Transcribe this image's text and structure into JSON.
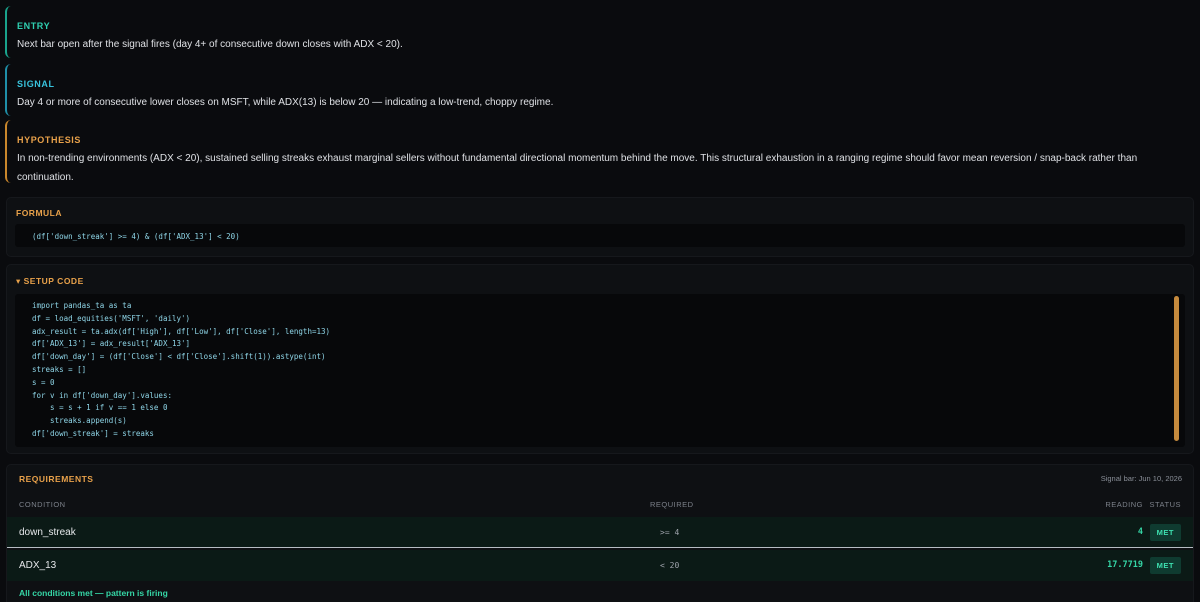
{
  "entry": {
    "label": "ENTRY",
    "text": "Next bar open after the signal fires (day 4+ of consecutive down closes with ADX < 20)."
  },
  "signal": {
    "label": "SIGNAL",
    "text": "Day 4 or more of consecutive lower closes on MSFT, while ADX(13) is below 20 — indicating a low-trend, choppy regime."
  },
  "hypothesis": {
    "label": "HYPOTHESIS",
    "text": "In non-trending environments (ADX < 20), sustained selling streaks exhaust marginal sellers without fundamental directional momentum behind the move. This structural exhaustion in a ranging regime should favor mean reversion / snap-back rather than continuation."
  },
  "formula": {
    "title": "FORMULA",
    "code": "(df['down_streak'] >= 4) & (df['ADX_13'] < 20)"
  },
  "setup": {
    "title": "▾ SETUP CODE",
    "lines": [
      "import pandas_ta as ta",
      "df = load_equities('MSFT', 'daily')",
      "adx_result = ta.adx(df['High'], df['Low'], df['Close'], length=13)",
      "df['ADX_13'] = adx_result['ADX_13']",
      "df['down_day'] = (df['Close'] < df['Close'].shift(1)).astype(int)",
      "streaks = []",
      "s = 0",
      "for v in df['down_day'].values:",
      "    s = s + 1 if v == 1 else 0",
      "    streaks.append(s)",
      "df['down_streak'] = streaks"
    ]
  },
  "requirements": {
    "title": "REQUIREMENTS",
    "signal_bar": "Signal bar: Jun 10, 2026",
    "headers": {
      "condition": "CONDITION",
      "required": "REQUIRED",
      "reading": "READING",
      "status": "STATUS"
    },
    "rows": [
      {
        "condition": "down_streak",
        "required": ">= 4",
        "reading": "4",
        "status": "MET"
      },
      {
        "condition": "ADX_13",
        "required": "< 20",
        "reading": "17.7719",
        "status": "MET"
      }
    ],
    "footer": "All conditions met — pattern is firing"
  }
}
